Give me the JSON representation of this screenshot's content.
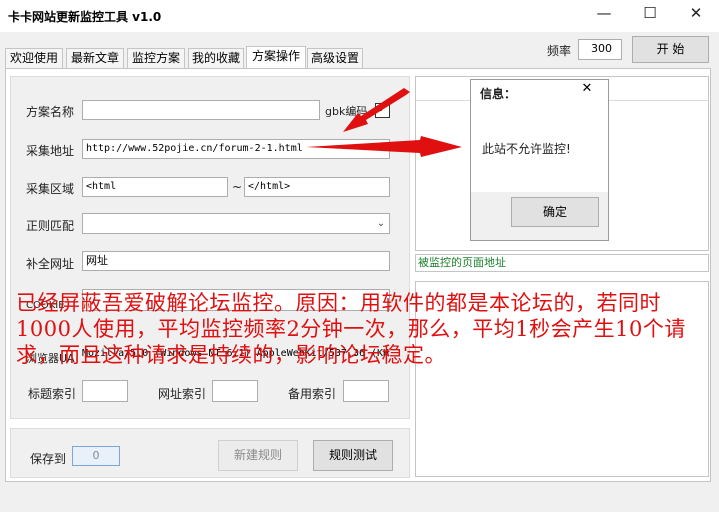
{
  "window": {
    "title": "卡卡网站更新监控工具 v1.0",
    "minimize": "—",
    "maximize": "☐",
    "close": "✕"
  },
  "header": {
    "rate_label": "频率",
    "rate_value": "300",
    "start_label": "开 始"
  },
  "tabs": [
    "欢迎使用",
    "最新文章",
    "监控方案",
    "我的收藏",
    "方案操作",
    "高级设置"
  ],
  "form": {
    "name_label": "方案名称",
    "name_value": "",
    "gbk_label": "gbk编码",
    "gbk_checked": "✔",
    "url_label": "采集地址",
    "url_value": "http://www.52pojie.cn/forum-2-1.html",
    "region_label": "采集区域",
    "region_start": "<html",
    "region_sep": "~",
    "region_end": "</html>",
    "regex_label": "正则匹配",
    "regex_value": "",
    "complete_label": "补全网址",
    "complete_value": "网址",
    "cookie_label": "COOKIE",
    "cookie_value": "",
    "ua_label": "浏览器UA",
    "ua_value": "Mozilla/5.0 (Windows NT 6.1) AppleWebKit/537.36 (KH",
    "title_index_label": "标题索引",
    "url_index_label": "网址索引",
    "backup_index_label": "备用索引"
  },
  "bottom": {
    "save_label": "保存到",
    "save_value": "0",
    "new_rule": "新建规则",
    "test_rule": "规则测试"
  },
  "dialog": {
    "title": "信息：",
    "message": "此站不允许监控!",
    "ok": "确定"
  },
  "right": {
    "monitored_label": "被监控的页面地址"
  },
  "annotation": "已经屏蔽吾爱破解论坛监控。原因：用软件的都是本论坛的，若同时1000人使用，平均监控频率2分钟一次，那么，平均1秒会产生10个请求，而且这种请求是持续的，影响论坛稳定。"
}
